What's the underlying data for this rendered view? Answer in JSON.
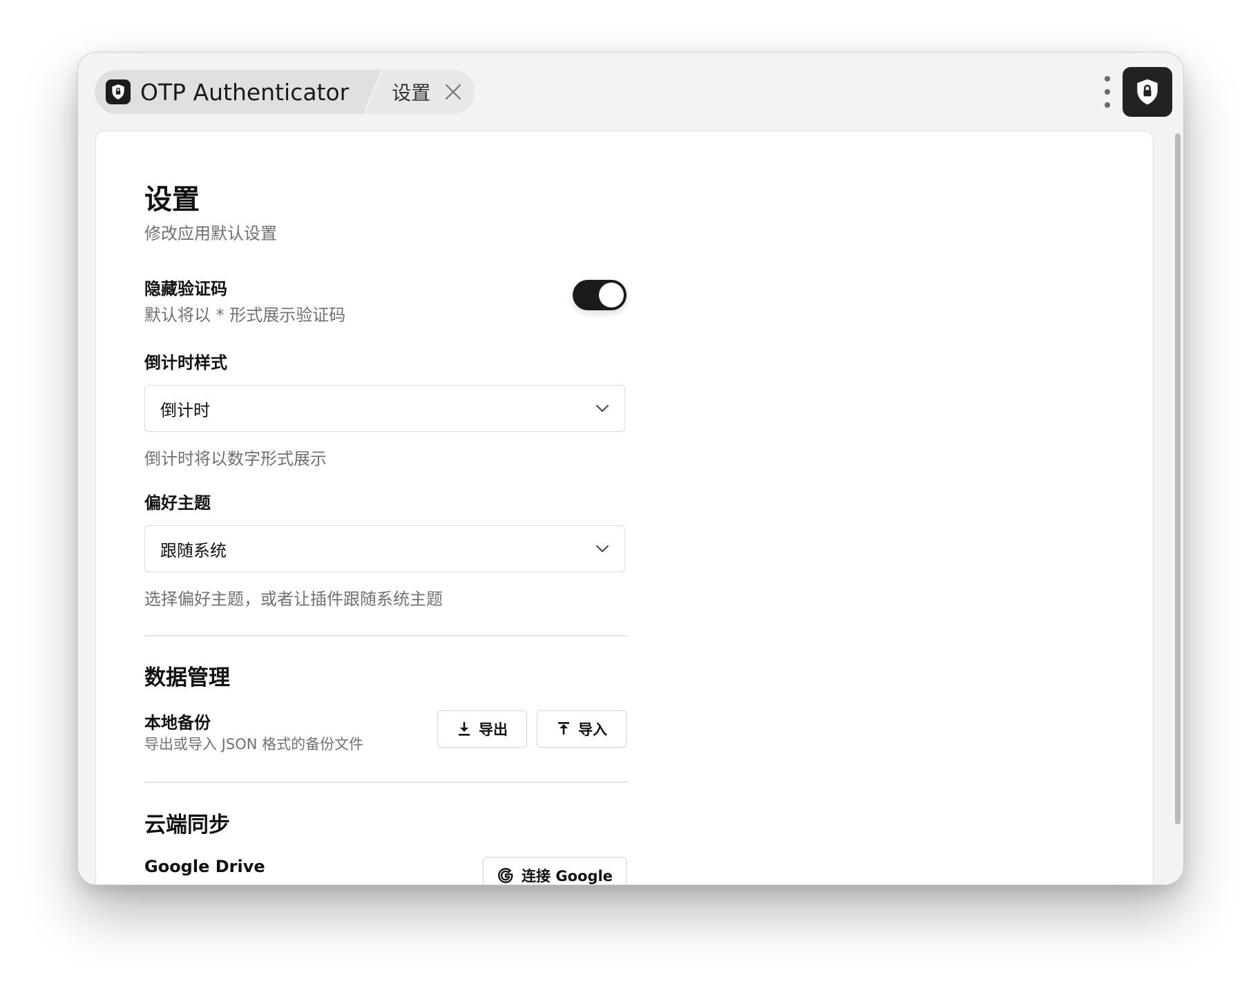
{
  "tabs": {
    "app_title": "OTP Authenticator",
    "settings_label": "设置"
  },
  "page": {
    "title": "设置",
    "subtitle": "修改应用默认设置"
  },
  "hide_code": {
    "label": "隐藏验证码",
    "description": "默认将以 * 形式展示验证码",
    "enabled": true
  },
  "countdown": {
    "label": "倒计时样式",
    "value": "倒计时",
    "description": "倒计时将以数字形式展示"
  },
  "theme": {
    "label": "偏好主题",
    "value": "跟随系统",
    "description": "选择偏好主题，或者让插件跟随系统主题"
  },
  "data_management": {
    "title": "数据管理",
    "local_backup_label": "本地备份",
    "local_backup_desc": "导出或导入 JSON 格式的备份文件",
    "export_label": "导出",
    "import_label": "导入"
  },
  "cloud_sync": {
    "title": "云端同步",
    "google_drive_label": "Google Drive",
    "connect_google_label": "连接 Google"
  },
  "icons": {
    "app": "shield-lock-icon",
    "close": "close-icon",
    "menu": "vertical-dots-icon",
    "chevron": "chevron-down-icon",
    "download": "download-icon",
    "upload": "upload-icon",
    "google": "google-g-icon"
  },
  "colors": {
    "toggle_on": "#1a1a1a",
    "text_primary": "#111111",
    "text_secondary": "#707070",
    "window_bg": "#f3f3f3",
    "tab_bg": "#e0e0e0"
  }
}
